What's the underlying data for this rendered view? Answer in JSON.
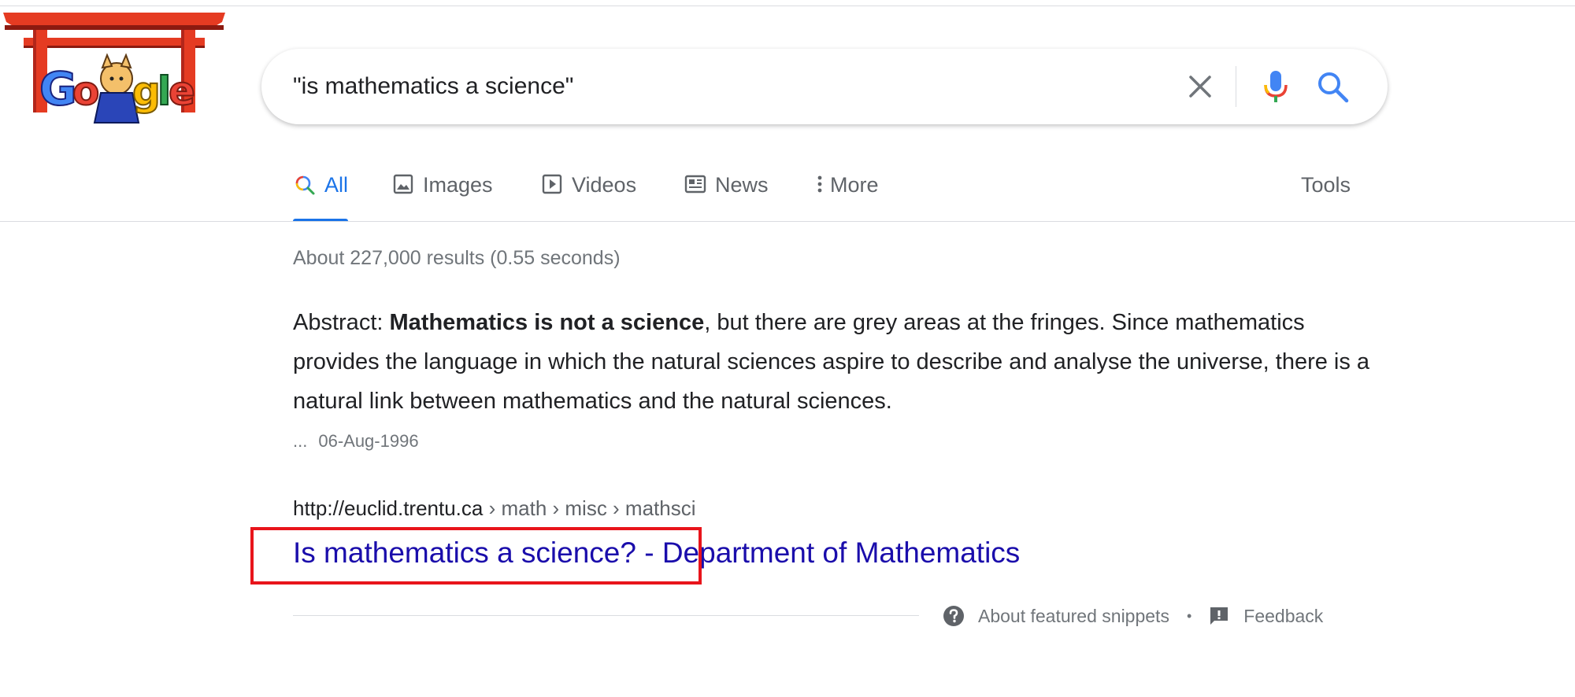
{
  "search": {
    "query": "\"is mathematics a science\""
  },
  "tabs": [
    {
      "label": "All",
      "icon": "search-icon"
    },
    {
      "label": "Images",
      "icon": "image-icon"
    },
    {
      "label": "Videos",
      "icon": "play-icon"
    },
    {
      "label": "News",
      "icon": "news-icon"
    },
    {
      "label": "More",
      "icon": "more-vert-icon"
    }
  ],
  "tools_label": "Tools",
  "result_stats": "About 227,000 results (0.55 seconds)",
  "snippet": {
    "prefix": "Abstract: ",
    "bold": "Mathematics is not a science",
    "rest": ", but there are grey areas at the fringes. Since mathematics provides the language in which the natural sciences aspire to describe and analyse the universe, there is a natural link between mathematics and the natural sciences.",
    "ellipsis": "...",
    "date": "06-Aug-1996"
  },
  "result": {
    "domain": "http://euclid.trentu.ca",
    "breadcrumbs": " › math › misc › mathsci",
    "title": "Is mathematics a science? - Department of Mathematics"
  },
  "footer": {
    "about_snippets": "About featured snippets",
    "separator": "•",
    "feedback": "Feedback"
  },
  "colors": {
    "link": "#1a0dab",
    "accent_blue": "#1a73e8",
    "highlight_red": "#e8141b"
  }
}
